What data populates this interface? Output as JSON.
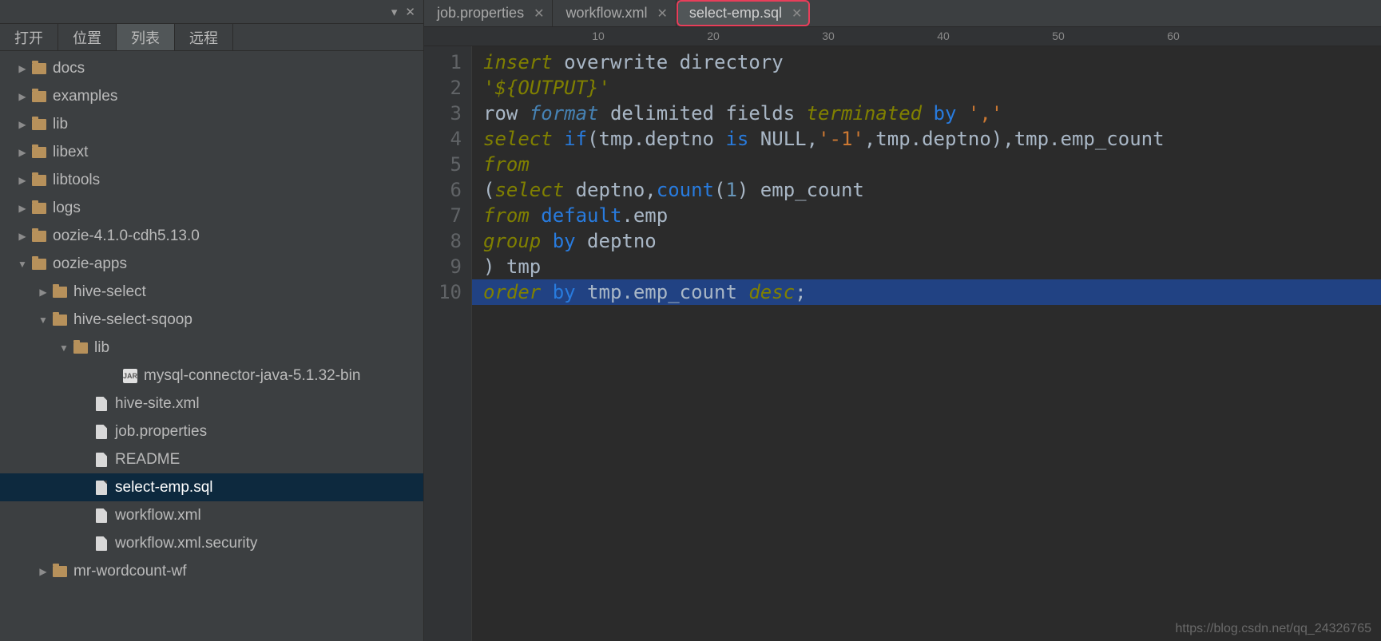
{
  "sidebar": {
    "top_controls": {
      "icon1": "▾",
      "icon2": "✕"
    },
    "tabs": [
      "打开",
      "位置",
      "列表",
      "远程"
    ],
    "active_tab_index": 2,
    "tree": [
      {
        "type": "folder",
        "label": "docs",
        "indent": 1,
        "expanded": false,
        "selected": false
      },
      {
        "type": "folder",
        "label": "examples",
        "indent": 1,
        "expanded": false,
        "selected": false
      },
      {
        "type": "folder",
        "label": "lib",
        "indent": 1,
        "expanded": false,
        "selected": false
      },
      {
        "type": "folder",
        "label": "libext",
        "indent": 1,
        "expanded": false,
        "selected": false
      },
      {
        "type": "folder",
        "label": "libtools",
        "indent": 1,
        "expanded": false,
        "selected": false
      },
      {
        "type": "folder",
        "label": "logs",
        "indent": 1,
        "expanded": false,
        "selected": false
      },
      {
        "type": "folder",
        "label": "oozie-4.1.0-cdh5.13.0",
        "indent": 1,
        "expanded": false,
        "selected": false
      },
      {
        "type": "folder",
        "label": "oozie-apps",
        "indent": 1,
        "expanded": true,
        "selected": false
      },
      {
        "type": "folder",
        "label": "hive-select",
        "indent": 2,
        "expanded": false,
        "selected": false
      },
      {
        "type": "folder",
        "label": "hive-select-sqoop",
        "indent": 2,
        "expanded": true,
        "selected": false
      },
      {
        "type": "folder",
        "label": "lib",
        "indent": 3,
        "expanded": true,
        "selected": false
      },
      {
        "type": "jar",
        "label": "mysql-connector-java-5.1.32-bin",
        "indent": 5,
        "selected": false
      },
      {
        "type": "file",
        "label": "hive-site.xml",
        "indent": 4,
        "selected": false
      },
      {
        "type": "file",
        "label": "job.properties",
        "indent": 4,
        "selected": false
      },
      {
        "type": "file",
        "label": "README",
        "indent": 4,
        "selected": false
      },
      {
        "type": "file",
        "label": "select-emp.sql",
        "indent": 4,
        "selected": true
      },
      {
        "type": "file",
        "label": "workflow.xml",
        "indent": 4,
        "selected": false
      },
      {
        "type": "file",
        "label": "workflow.xml.security",
        "indent": 4,
        "selected": false
      },
      {
        "type": "folder",
        "label": "mr-wordcount-wf",
        "indent": 2,
        "expanded": false,
        "selected": false
      }
    ]
  },
  "editor": {
    "tabs": [
      {
        "label": "job.properties",
        "active": false
      },
      {
        "label": "workflow.xml",
        "active": false
      },
      {
        "label": "select-emp.sql",
        "active": true
      }
    ],
    "ruler": [
      10,
      20,
      30,
      40,
      50,
      60
    ],
    "code_lines": [
      {
        "n": 1,
        "tokens": [
          {
            "t": "insert",
            "c": "k-olive"
          },
          {
            "t": " "
          },
          {
            "t": "overwrite directory",
            "c": ""
          }
        ]
      },
      {
        "n": 2,
        "tokens": [
          {
            "t": "'${OUTPUT}'",
            "c": "k-olive"
          }
        ]
      },
      {
        "n": 3,
        "tokens": [
          {
            "t": "row ",
            "c": ""
          },
          {
            "t": "format",
            "c": "k-cyan"
          },
          {
            "t": " delimited fields ",
            "c": ""
          },
          {
            "t": "terminated",
            "c": "k-olive"
          },
          {
            "t": " ",
            "c": ""
          },
          {
            "t": "by",
            "c": "k-blue"
          },
          {
            "t": " ",
            "c": ""
          },
          {
            "t": "','",
            "c": "k-str"
          }
        ]
      },
      {
        "n": 4,
        "tokens": [
          {
            "t": "select",
            "c": "k-olive"
          },
          {
            "t": " ",
            "c": ""
          },
          {
            "t": "if",
            "c": "k-blue"
          },
          {
            "t": "(tmp.deptno ",
            "c": ""
          },
          {
            "t": "is",
            "c": "k-blue"
          },
          {
            "t": " NULL,",
            "c": ""
          },
          {
            "t": "'-1'",
            "c": "k-str"
          },
          {
            "t": ",tmp.deptno),tmp.emp_count",
            "c": ""
          }
        ]
      },
      {
        "n": 5,
        "tokens": [
          {
            "t": "from",
            "c": "k-olive"
          }
        ]
      },
      {
        "n": 6,
        "tokens": [
          {
            "t": "(",
            "c": ""
          },
          {
            "t": "select",
            "c": "k-olive"
          },
          {
            "t": " deptno,",
            "c": ""
          },
          {
            "t": "count",
            "c": "k-blue"
          },
          {
            "t": "(",
            "c": ""
          },
          {
            "t": "1",
            "c": "k-num"
          },
          {
            "t": ") emp_count",
            "c": ""
          }
        ]
      },
      {
        "n": 7,
        "tokens": [
          {
            "t": "from",
            "c": "k-olive"
          },
          {
            "t": " ",
            "c": ""
          },
          {
            "t": "default",
            "c": "k-blue"
          },
          {
            "t": ".emp",
            "c": ""
          }
        ]
      },
      {
        "n": 8,
        "tokens": [
          {
            "t": "group",
            "c": "k-olive"
          },
          {
            "t": " ",
            "c": ""
          },
          {
            "t": "by",
            "c": "k-blue"
          },
          {
            "t": " deptno",
            "c": ""
          }
        ]
      },
      {
        "n": 9,
        "tokens": [
          {
            "t": ") tmp",
            "c": ""
          }
        ]
      },
      {
        "n": 10,
        "hl": true,
        "tokens": [
          {
            "t": "order",
            "c": "k-olive"
          },
          {
            "t": " ",
            "c": ""
          },
          {
            "t": "by",
            "c": "k-blue"
          },
          {
            "t": " tmp.emp_count ",
            "c": ""
          },
          {
            "t": "desc",
            "c": "k-olive"
          },
          {
            "t": ";",
            "c": ""
          }
        ]
      }
    ]
  },
  "watermark": "https://blog.csdn.net/qq_24326765"
}
